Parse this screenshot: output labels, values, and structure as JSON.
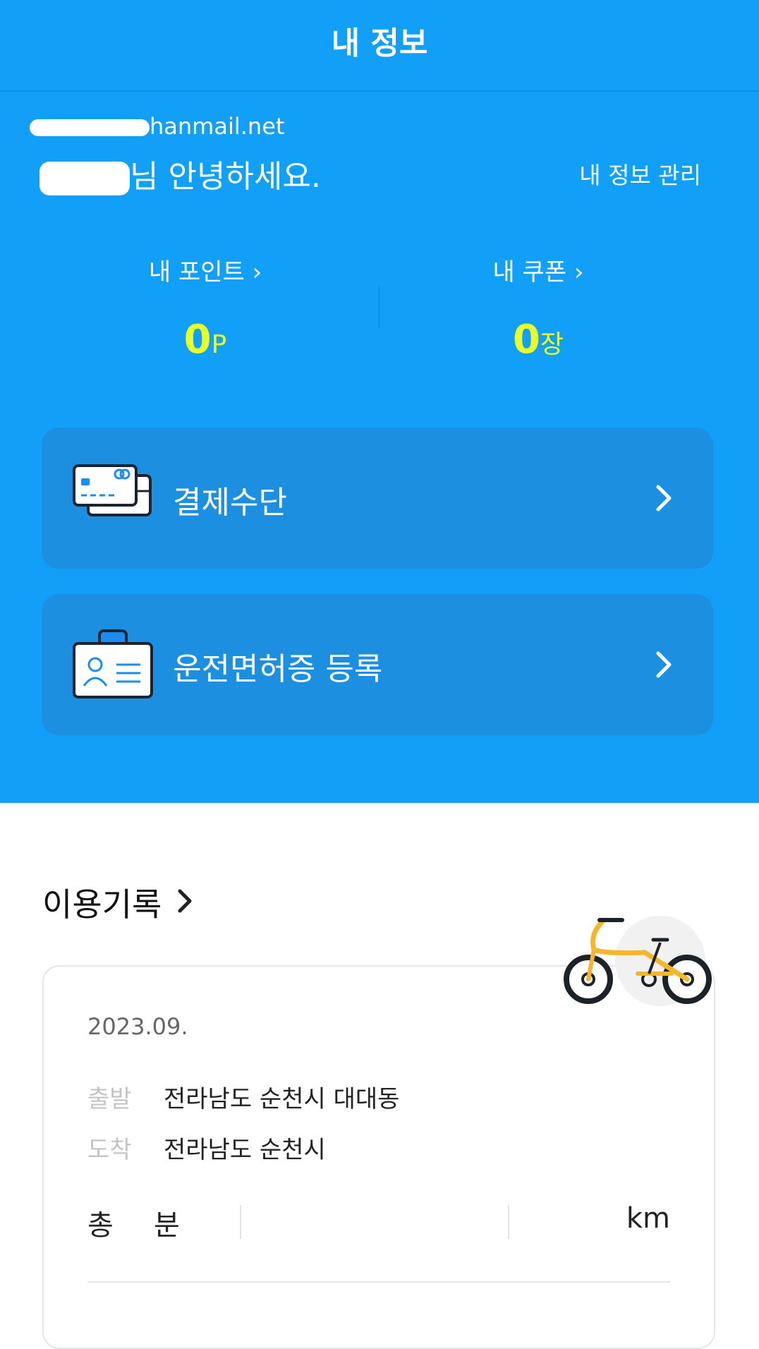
{
  "header": {
    "title": "내 정보"
  },
  "profile": {
    "email_visible": "hanmail.net",
    "greeting": "님 안녕하세요.",
    "manage_link": "내 정보 관리"
  },
  "stats": {
    "points": {
      "label": "내 포인트 ›",
      "value": "0",
      "unit": "P"
    },
    "coupons": {
      "label": "내 쿠폰 ›",
      "value": "0",
      "unit": "장"
    }
  },
  "menu": {
    "payment": {
      "label": "결제수단",
      "icon": "credit-card-icon"
    },
    "license": {
      "label": "운전면허증 등록",
      "icon": "id-card-icon"
    }
  },
  "history": {
    "title": "이용기록",
    "record": {
      "date": "2023.09.",
      "start_label": "출발",
      "start_value": "전라남도 순천시 대대동",
      "end_label": "도착",
      "end_value": "전라남도 순천시",
      "total_prefix": "총",
      "minutes_unit": "분",
      "distance_unit": "km"
    }
  },
  "colors": {
    "primary": "#129ff8",
    "card": "#1d8fe0",
    "highlight": "#e9ff2a",
    "bike_frame": "#f5b52e"
  }
}
